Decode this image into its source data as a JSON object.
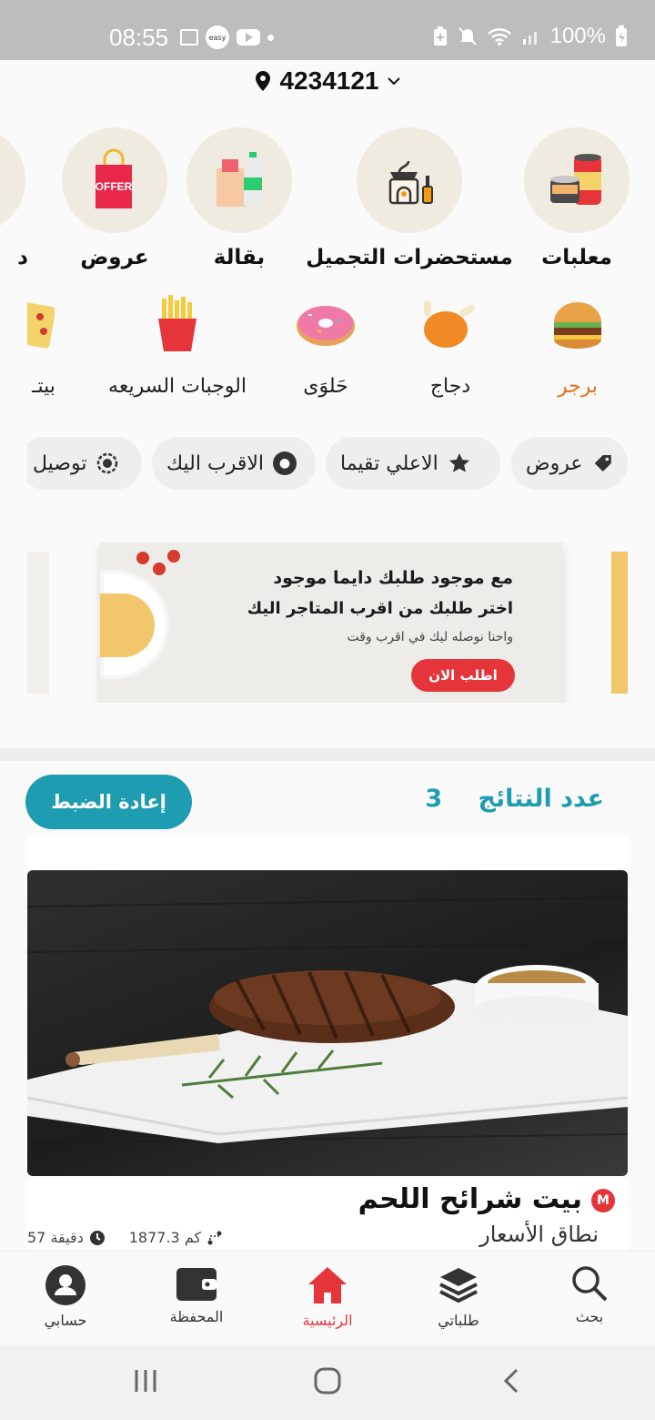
{
  "status_bar": {
    "time": "08:55",
    "battery": "100%",
    "easy_label": "easy"
  },
  "location": {
    "value": "4234121"
  },
  "categories": [
    {
      "label": "معلبات",
      "icon": "canned-food-icon"
    },
    {
      "label": "مستحضرات التجميل",
      "icon": "cosmetics-icon"
    },
    {
      "label": "بقالة",
      "icon": "grocery-icon"
    },
    {
      "label": "عروض",
      "icon": "offer-bag-icon",
      "badge": "OFFER"
    },
    {
      "label": "د",
      "icon": "partial-category-icon"
    }
  ],
  "food_types": [
    {
      "label": "برجر",
      "active": true
    },
    {
      "label": "دجاج"
    },
    {
      "label": "حَلوَى"
    },
    {
      "label": "الوجبات السريعه"
    },
    {
      "label": "بيتـ"
    }
  ],
  "filter_chips": [
    {
      "label": "عروض",
      "icon": "tag-icon"
    },
    {
      "label": "الاعلي تقيما",
      "icon": "star-icon"
    },
    {
      "label": "الاقرب اليك",
      "icon": "location-pin-icon"
    },
    {
      "label": "توصيل",
      "icon": "delivery-timer-icon"
    }
  ],
  "banner": {
    "line1": "مع موجود طلبك دايما موجود",
    "line2": "اختر طلبك من اقرب المتاجر اليك",
    "line3": "واحنا نوصله ليك في اقرب وقت",
    "cta": "اطلب الان"
  },
  "results": {
    "label": "عدد النتائج",
    "count": "3",
    "reset": "إعادة الضبط"
  },
  "restaurant": {
    "name": "بيت شرائح اللحم",
    "logo_letter": "M",
    "price_range": "نطاق الأسعار",
    "distance": "1877.3 كم",
    "time": "57 دقيقة"
  },
  "bottom_nav": [
    {
      "label": "حسابي",
      "icon": "account-icon"
    },
    {
      "label": "المحفظة",
      "icon": "wallet-icon"
    },
    {
      "label": "الرئيسية",
      "icon": "home-icon",
      "active": true
    },
    {
      "label": "طلباتي",
      "icon": "orders-layers-icon"
    },
    {
      "label": "بحث",
      "icon": "search-icon"
    }
  ],
  "colors": {
    "accent": "#1e9cb1",
    "brand_red": "#e5353b",
    "active_food": "#e8711d"
  }
}
